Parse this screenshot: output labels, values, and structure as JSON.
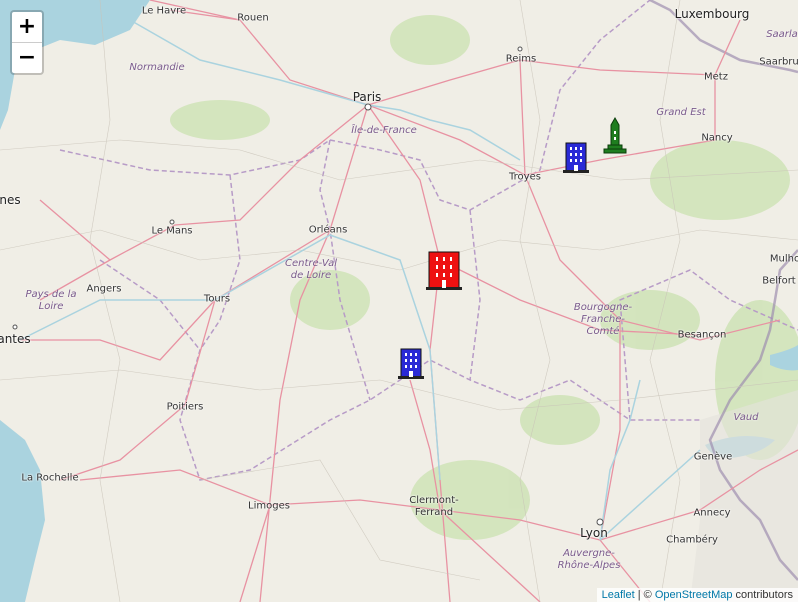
{
  "map": {
    "zoom_in_label": "+",
    "zoom_out_label": "−",
    "attribution": {
      "leaflet": "Leaflet",
      "separator": " | © ",
      "osm": "OpenStreetMap",
      "suffix": " contributors"
    },
    "cities": {
      "le_havre": "Le Havre",
      "rouen": "Rouen",
      "paris": "Paris",
      "reims": "Reims",
      "luxembourg": "Luxembourg",
      "metz": "Metz",
      "saarbru": "Saarbru",
      "nancy": "Nancy",
      "troyes": "Troyes",
      "le_mans": "Le Mans",
      "orleans": "Orléans",
      "angers": "Angers",
      "tours": "Tours",
      "nantes": "antes",
      "rennes": "nes",
      "poitiers": "Poitiers",
      "la_rochelle": "La Rochelle",
      "limoges": "Limoges",
      "clermont": "Clermont-\nFerrand",
      "lyon": "Lyon",
      "geneve": "Genève",
      "annecy": "Annecy",
      "chambery": "Chambéry",
      "besancon": "Besançon",
      "belfort": "Belfort",
      "mulho": "Mulho"
    },
    "regions": {
      "normandie": "Normandie",
      "idf": "Île-de-France",
      "grand_est": "Grand Est",
      "cvl": "Centre-Val\nde Loire",
      "pdl": "Pays de la\nLoire",
      "bfc": "Bourgogne-\nFranche-\nComté",
      "ara": "Auvergne-\nRhône-Alpes",
      "saarla": "Saarla",
      "vaud": "Vaud"
    },
    "markers": [
      {
        "icon": "building-icon",
        "color": "#2a2ad6"
      },
      {
        "icon": "building-icon",
        "color": "#ee1111"
      },
      {
        "icon": "building-icon",
        "color": "#2a2ad6"
      },
      {
        "icon": "monument-icon",
        "color": "#1f7d1f"
      }
    ]
  }
}
